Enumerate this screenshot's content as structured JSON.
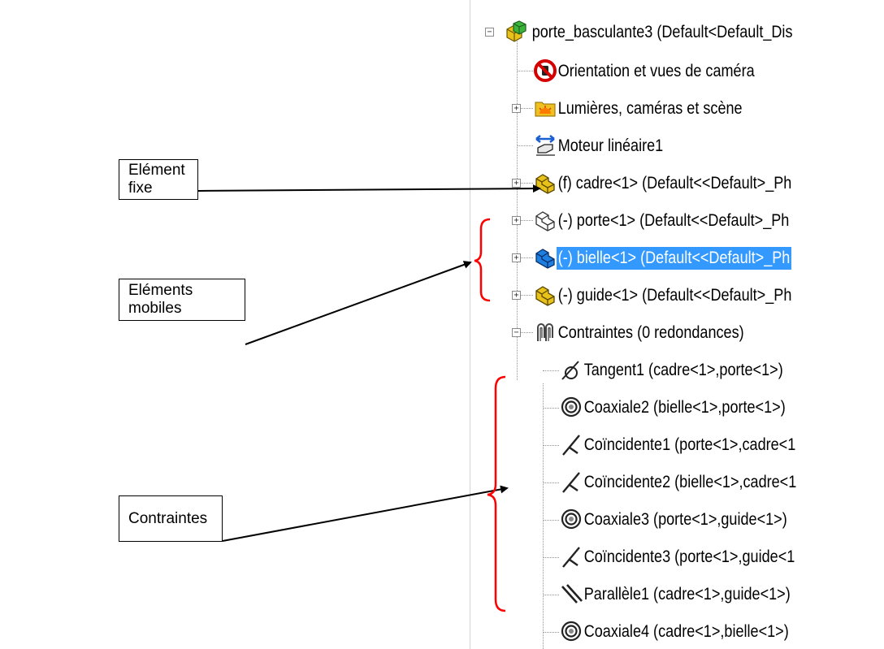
{
  "callouts": {
    "fixed": "Elément fixe",
    "mobile": "Eléments mobiles",
    "constraints": "Contraintes"
  },
  "tree": {
    "root": "porte_basculante3  (Default<Default_Dis",
    "orientation": "Orientation et vues de caméra",
    "lights": "Lumières, caméras et scène",
    "motor": "Moteur linéaire1",
    "cadre": "(f) cadre<1> (Default<<Default>_Ph",
    "porte": "(-) porte<1> (Default<<Default>_Ph",
    "bielle": "(-) bielle<1> (Default<<Default>_Ph",
    "guide": "(-) guide<1> (Default<<Default>_Ph",
    "constraints_folder": "Contraintes (0 redondances)",
    "c1": "Tangent1 (cadre<1>,porte<1>)",
    "c2": "Coaxiale2 (bielle<1>,porte<1>)",
    "c3": "Coïncidente1 (porte<1>,cadre<1",
    "c4": "Coïncidente2 (bielle<1>,cadre<1",
    "c5": "Coaxiale3 (porte<1>,guide<1>)",
    "c6": "Coïncidente3 (porte<1>,guide<1",
    "c7": "Parallèle1 (cadre<1>,guide<1>)",
    "c8": "Coaxiale4 (cadre<1>,bielle<1>)"
  },
  "colors": {
    "selection": "#3399ff",
    "annotation_bracket": "#ff0000",
    "part_fixed": "#e8c21a",
    "part_selected": "#1f7fe0"
  },
  "icons": {
    "root": "assembly-icon",
    "orientation": "camera-orientation-icon",
    "lights": "lights-folder-icon",
    "motor": "linear-motor-icon",
    "part": "part-icon",
    "constraints_folder": "mates-folder-icon",
    "tangent": "tangent-mate-icon",
    "coaxial": "coaxial-mate-icon",
    "coincident": "coincident-mate-icon",
    "parallel": "parallel-mate-icon"
  }
}
